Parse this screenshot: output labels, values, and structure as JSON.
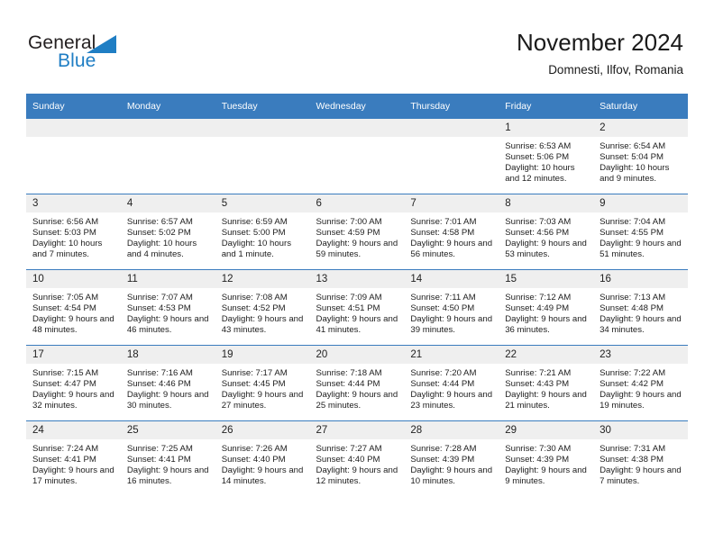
{
  "brand": {
    "word1": "General",
    "word2": "Blue",
    "triangle_color": "#1f7ec4",
    "text_color": "#231f20"
  },
  "header": {
    "title": "November 2024",
    "subtitle": "Domnesti, Ilfov, Romania"
  },
  "colors": {
    "header_bar": "#3a7cbe",
    "day_number_bg": "#efefef",
    "row_rule": "#3a7cbe"
  },
  "weekdays": [
    "Sunday",
    "Monday",
    "Tuesday",
    "Wednesday",
    "Thursday",
    "Friday",
    "Saturday"
  ],
  "weeks": [
    [
      {
        "day": "",
        "empty": true
      },
      {
        "day": "",
        "empty": true
      },
      {
        "day": "",
        "empty": true
      },
      {
        "day": "",
        "empty": true
      },
      {
        "day": "",
        "empty": true
      },
      {
        "day": "1",
        "sunrise": "Sunrise: 6:53 AM",
        "sunset": "Sunset: 5:06 PM",
        "daylight": "Daylight: 10 hours and 12 minutes."
      },
      {
        "day": "2",
        "sunrise": "Sunrise: 6:54 AM",
        "sunset": "Sunset: 5:04 PM",
        "daylight": "Daylight: 10 hours and 9 minutes."
      }
    ],
    [
      {
        "day": "3",
        "sunrise": "Sunrise: 6:56 AM",
        "sunset": "Sunset: 5:03 PM",
        "daylight": "Daylight: 10 hours and 7 minutes."
      },
      {
        "day": "4",
        "sunrise": "Sunrise: 6:57 AM",
        "sunset": "Sunset: 5:02 PM",
        "daylight": "Daylight: 10 hours and 4 minutes."
      },
      {
        "day": "5",
        "sunrise": "Sunrise: 6:59 AM",
        "sunset": "Sunset: 5:00 PM",
        "daylight": "Daylight: 10 hours and 1 minute."
      },
      {
        "day": "6",
        "sunrise": "Sunrise: 7:00 AM",
        "sunset": "Sunset: 4:59 PM",
        "daylight": "Daylight: 9 hours and 59 minutes."
      },
      {
        "day": "7",
        "sunrise": "Sunrise: 7:01 AM",
        "sunset": "Sunset: 4:58 PM",
        "daylight": "Daylight: 9 hours and 56 minutes."
      },
      {
        "day": "8",
        "sunrise": "Sunrise: 7:03 AM",
        "sunset": "Sunset: 4:56 PM",
        "daylight": "Daylight: 9 hours and 53 minutes."
      },
      {
        "day": "9",
        "sunrise": "Sunrise: 7:04 AM",
        "sunset": "Sunset: 4:55 PM",
        "daylight": "Daylight: 9 hours and 51 minutes."
      }
    ],
    [
      {
        "day": "10",
        "sunrise": "Sunrise: 7:05 AM",
        "sunset": "Sunset: 4:54 PM",
        "daylight": "Daylight: 9 hours and 48 minutes."
      },
      {
        "day": "11",
        "sunrise": "Sunrise: 7:07 AM",
        "sunset": "Sunset: 4:53 PM",
        "daylight": "Daylight: 9 hours and 46 minutes."
      },
      {
        "day": "12",
        "sunrise": "Sunrise: 7:08 AM",
        "sunset": "Sunset: 4:52 PM",
        "daylight": "Daylight: 9 hours and 43 minutes."
      },
      {
        "day": "13",
        "sunrise": "Sunrise: 7:09 AM",
        "sunset": "Sunset: 4:51 PM",
        "daylight": "Daylight: 9 hours and 41 minutes."
      },
      {
        "day": "14",
        "sunrise": "Sunrise: 7:11 AM",
        "sunset": "Sunset: 4:50 PM",
        "daylight": "Daylight: 9 hours and 39 minutes."
      },
      {
        "day": "15",
        "sunrise": "Sunrise: 7:12 AM",
        "sunset": "Sunset: 4:49 PM",
        "daylight": "Daylight: 9 hours and 36 minutes."
      },
      {
        "day": "16",
        "sunrise": "Sunrise: 7:13 AM",
        "sunset": "Sunset: 4:48 PM",
        "daylight": "Daylight: 9 hours and 34 minutes."
      }
    ],
    [
      {
        "day": "17",
        "sunrise": "Sunrise: 7:15 AM",
        "sunset": "Sunset: 4:47 PM",
        "daylight": "Daylight: 9 hours and 32 minutes."
      },
      {
        "day": "18",
        "sunrise": "Sunrise: 7:16 AM",
        "sunset": "Sunset: 4:46 PM",
        "daylight": "Daylight: 9 hours and 30 minutes."
      },
      {
        "day": "19",
        "sunrise": "Sunrise: 7:17 AM",
        "sunset": "Sunset: 4:45 PM",
        "daylight": "Daylight: 9 hours and 27 minutes."
      },
      {
        "day": "20",
        "sunrise": "Sunrise: 7:18 AM",
        "sunset": "Sunset: 4:44 PM",
        "daylight": "Daylight: 9 hours and 25 minutes."
      },
      {
        "day": "21",
        "sunrise": "Sunrise: 7:20 AM",
        "sunset": "Sunset: 4:44 PM",
        "daylight": "Daylight: 9 hours and 23 minutes."
      },
      {
        "day": "22",
        "sunrise": "Sunrise: 7:21 AM",
        "sunset": "Sunset: 4:43 PM",
        "daylight": "Daylight: 9 hours and 21 minutes."
      },
      {
        "day": "23",
        "sunrise": "Sunrise: 7:22 AM",
        "sunset": "Sunset: 4:42 PM",
        "daylight": "Daylight: 9 hours and 19 minutes."
      }
    ],
    [
      {
        "day": "24",
        "sunrise": "Sunrise: 7:24 AM",
        "sunset": "Sunset: 4:41 PM",
        "daylight": "Daylight: 9 hours and 17 minutes."
      },
      {
        "day": "25",
        "sunrise": "Sunrise: 7:25 AM",
        "sunset": "Sunset: 4:41 PM",
        "daylight": "Daylight: 9 hours and 16 minutes."
      },
      {
        "day": "26",
        "sunrise": "Sunrise: 7:26 AM",
        "sunset": "Sunset: 4:40 PM",
        "daylight": "Daylight: 9 hours and 14 minutes."
      },
      {
        "day": "27",
        "sunrise": "Sunrise: 7:27 AM",
        "sunset": "Sunset: 4:40 PM",
        "daylight": "Daylight: 9 hours and 12 minutes."
      },
      {
        "day": "28",
        "sunrise": "Sunrise: 7:28 AM",
        "sunset": "Sunset: 4:39 PM",
        "daylight": "Daylight: 9 hours and 10 minutes."
      },
      {
        "day": "29",
        "sunrise": "Sunrise: 7:30 AM",
        "sunset": "Sunset: 4:39 PM",
        "daylight": "Daylight: 9 hours and 9 minutes."
      },
      {
        "day": "30",
        "sunrise": "Sunrise: 7:31 AM",
        "sunset": "Sunset: 4:38 PM",
        "daylight": "Daylight: 9 hours and 7 minutes."
      }
    ]
  ]
}
